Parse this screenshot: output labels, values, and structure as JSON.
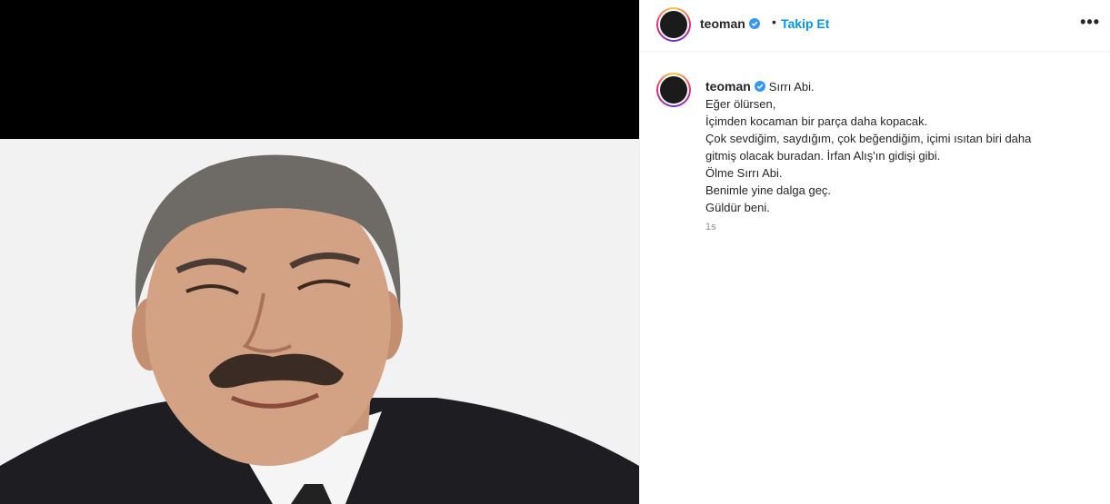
{
  "post": {
    "username": "teoman",
    "follow_label": "Takip Et",
    "separator": "•",
    "more_label": "•••",
    "caption_first": "Sırrı Abi.",
    "caption_lines": [
      "Eğer ölürsen,",
      "İçimden kocaman bir parça daha kopacak.",
      "Çok sevdiğim, saydığım, çok beğendiğim, içimi ısıtan biri daha",
      "gitmiş olacak buradan. İrfan Alış'ın gidişi gibi.",
      "Ölme Sırrı Abi.",
      "Benimle yine dalga geç.",
      "Güldür beni."
    ],
    "time_ago": "1s"
  },
  "colors": {
    "link_blue": "#0095f6",
    "verified_blue": "#3897f0",
    "text": "#262626",
    "muted": "#8e8e8e"
  },
  "icons": {
    "verified": "verified-badge-icon",
    "more": "more-options-icon"
  }
}
